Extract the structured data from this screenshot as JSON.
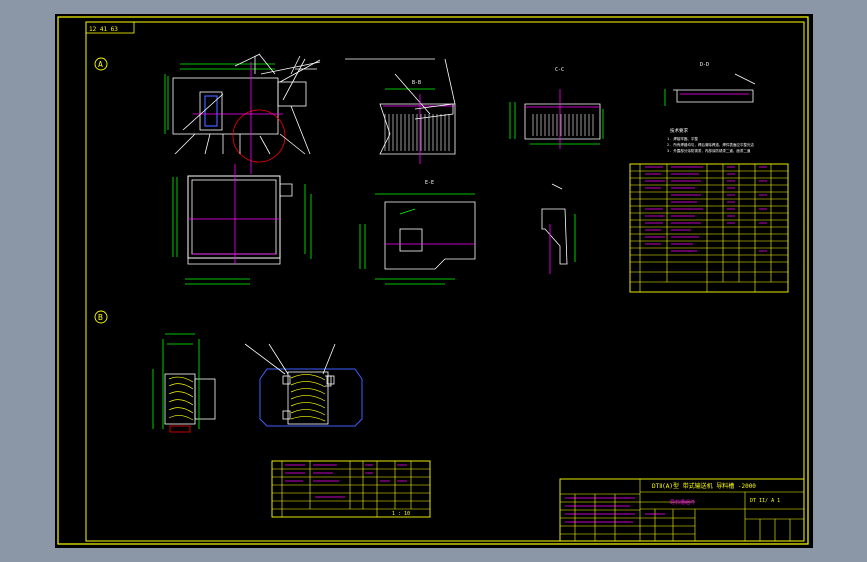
{
  "drawing": {
    "corner_code": "12 41 63",
    "view_a_marker": "A",
    "view_b_marker": "B",
    "section_label_1": "B-B",
    "section_label_2": "C-C",
    "section_label_3": "D-D",
    "section_label_4": "E-E",
    "notes_title": "技术要求",
    "notes": [
      "1. 焊接牢固、平整",
      "2. 所有焊缝均匀，焊后清除焊渣，焊件表面应平整光洁",
      "3. 外露部分涂防锈漆，内部涂防锈漆二道，面漆二道"
    ],
    "title_block": {
      "project": "DTⅡ(A)型  带式输送机  导料槽  -2000",
      "part_name": "导料槽组件",
      "code": "DT II/ A 1",
      "scale": "1 : 10"
    }
  },
  "colors": {
    "background": "#000000",
    "frame": "#ffff00",
    "outline": "#ffffff",
    "center_line": "#ff00ff",
    "dimension": "#00ff00",
    "hidden": "#ff0000",
    "blue": "#4060ff",
    "grain": "#ffff00"
  }
}
